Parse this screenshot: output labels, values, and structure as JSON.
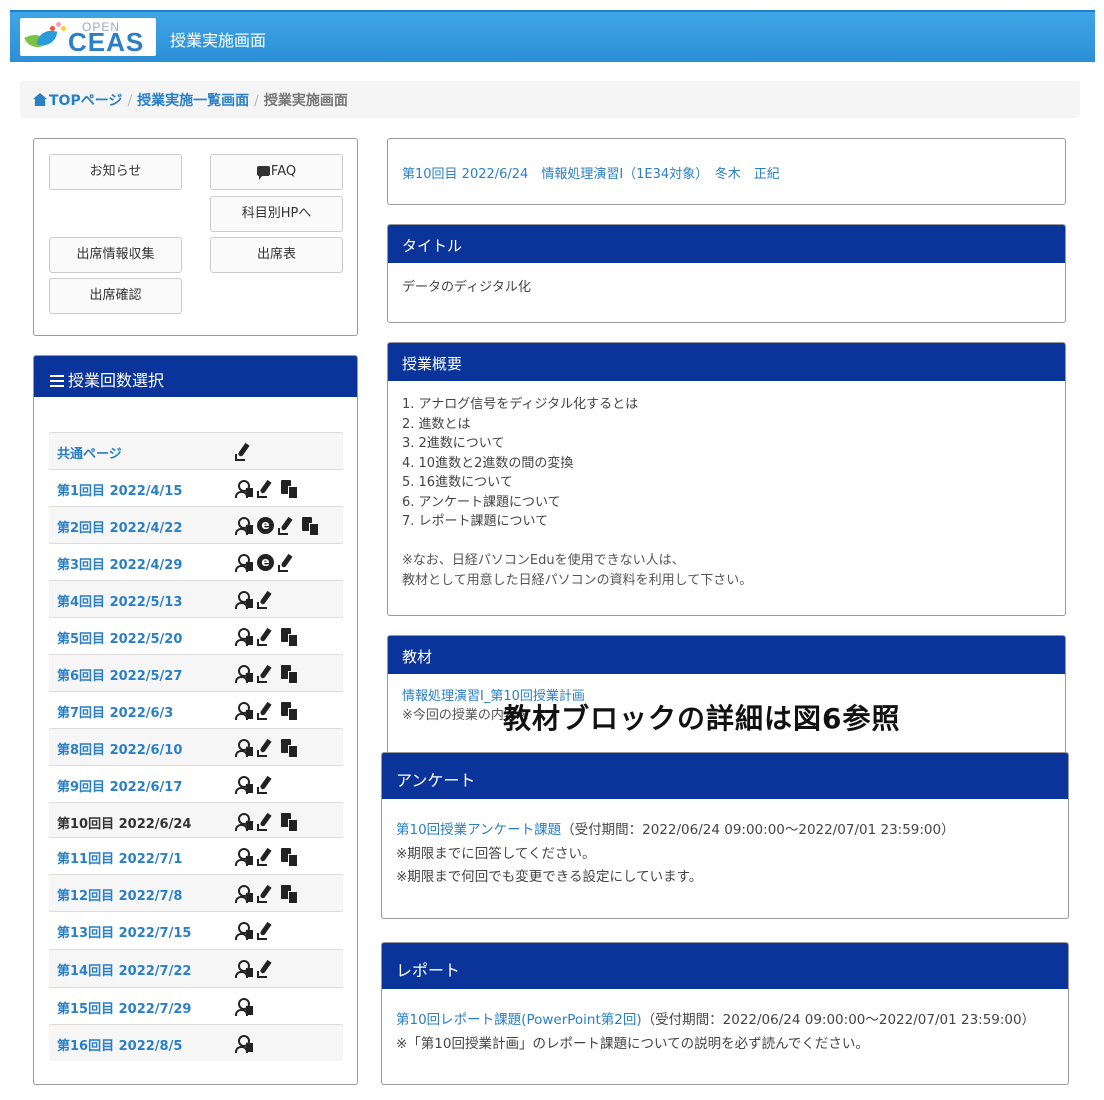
{
  "header": {
    "logo_small": "OPEN",
    "logo_big": "CEAS",
    "title": "授業実施画面",
    "colors": {
      "bar": "#3fa6e6",
      "panel_head": "#0a349a",
      "link": "#2a7fc6"
    }
  },
  "breadcrumb": {
    "home": "TOPページ",
    "list": "授業実施一覧画面",
    "current": "授業実施画面",
    "sep": "/"
  },
  "buttons": {
    "news": "お知らせ",
    "faq": "FAQ",
    "subject_hp": "科目別HPへ",
    "attendance_collect": "出席情報収集",
    "attendance_table": "出席表",
    "attendance_check": "出席確認"
  },
  "lesson_select": {
    "title": "授業回数選択",
    "rows": [
      {
        "label": "共通ページ",
        "icons": [
          "pen"
        ]
      },
      {
        "label": "第1回目 2022/4/15",
        "icons": [
          "person",
          "pen",
          "doc"
        ]
      },
      {
        "label": "第2回目 2022/4/22",
        "icons": [
          "person",
          "e",
          "pen",
          "doc"
        ]
      },
      {
        "label": "第3回目 2022/4/29",
        "icons": [
          "person",
          "e",
          "pen"
        ]
      },
      {
        "label": "第4回目 2022/5/13",
        "icons": [
          "person",
          "pen"
        ]
      },
      {
        "label": "第5回目 2022/5/20",
        "icons": [
          "person",
          "pen",
          "doc"
        ]
      },
      {
        "label": "第6回目 2022/5/27",
        "icons": [
          "person",
          "pen",
          "doc"
        ]
      },
      {
        "label": "第7回目 2022/6/3",
        "icons": [
          "person",
          "pen",
          "doc"
        ]
      },
      {
        "label": "第8回目 2022/6/10",
        "icons": [
          "person",
          "pen",
          "doc"
        ]
      },
      {
        "label": "第9回目 2022/6/17",
        "icons": [
          "person",
          "pen"
        ]
      },
      {
        "label": "第10回目 2022/6/24",
        "icons": [
          "person",
          "pen",
          "doc"
        ],
        "current": true
      },
      {
        "label": "第11回目 2022/7/1",
        "icons": [
          "person",
          "pen",
          "doc"
        ]
      },
      {
        "label": "第12回目 2022/7/8",
        "icons": [
          "person",
          "pen",
          "doc"
        ]
      },
      {
        "label": "第13回目 2022/7/15",
        "icons": [
          "person",
          "pen"
        ]
      },
      {
        "label": "第14回目 2022/7/22",
        "icons": [
          "person",
          "pen"
        ]
      },
      {
        "label": "第15回目 2022/7/29",
        "icons": [
          "person"
        ]
      },
      {
        "label": "第16回目 2022/8/5",
        "icons": [
          "person"
        ]
      }
    ]
  },
  "lesson_info": "第10回目 2022/6/24　情報処理演習Ⅰ（1E34対象）　冬木　正紀",
  "title_panel": {
    "head": "タイトル",
    "body": "データのディジタル化"
  },
  "summary_panel": {
    "head": "授業概要",
    "lines": [
      "1. アナログ信号をディジタル化するとは",
      "2. 進数とは",
      "3. 2進数について",
      "4. 10進数と2進数の間の変換",
      "5. 16進数について",
      "6. アンケート課題について",
      "7. レポート課題について"
    ],
    "note1": "※なお、日経パソコンEduを使用できない人は、",
    "note2": "教材として用意した日経パソコンの資料を利用して下さい。"
  },
  "material_panel": {
    "head": "教材",
    "link": "情報処理演習Ⅰ_第10回授業計画",
    "note": "※今回の授業の内容を"
  },
  "overlay_caption": "教材ブロックの詳細は図6参照",
  "survey_panel": {
    "head": "アンケート",
    "link": "第10回授業アンケート課題",
    "period": "（受付期間：2022/06/24 09:00:00～2022/07/01 23:59:00）",
    "note1": "※期限までに回答してください。",
    "note2": "※期限まで何回でも変更できる設定にしています。"
  },
  "report_panel": {
    "head": "レポート",
    "link": "第10回レポート課題(PowerPoint第2回)",
    "period": "（受付期間：2022/06/24 09:00:00～2022/07/01 23:59:00）",
    "note": "※「第10回授業計画」のレポート課題についての説明を必ず読んでください。"
  }
}
